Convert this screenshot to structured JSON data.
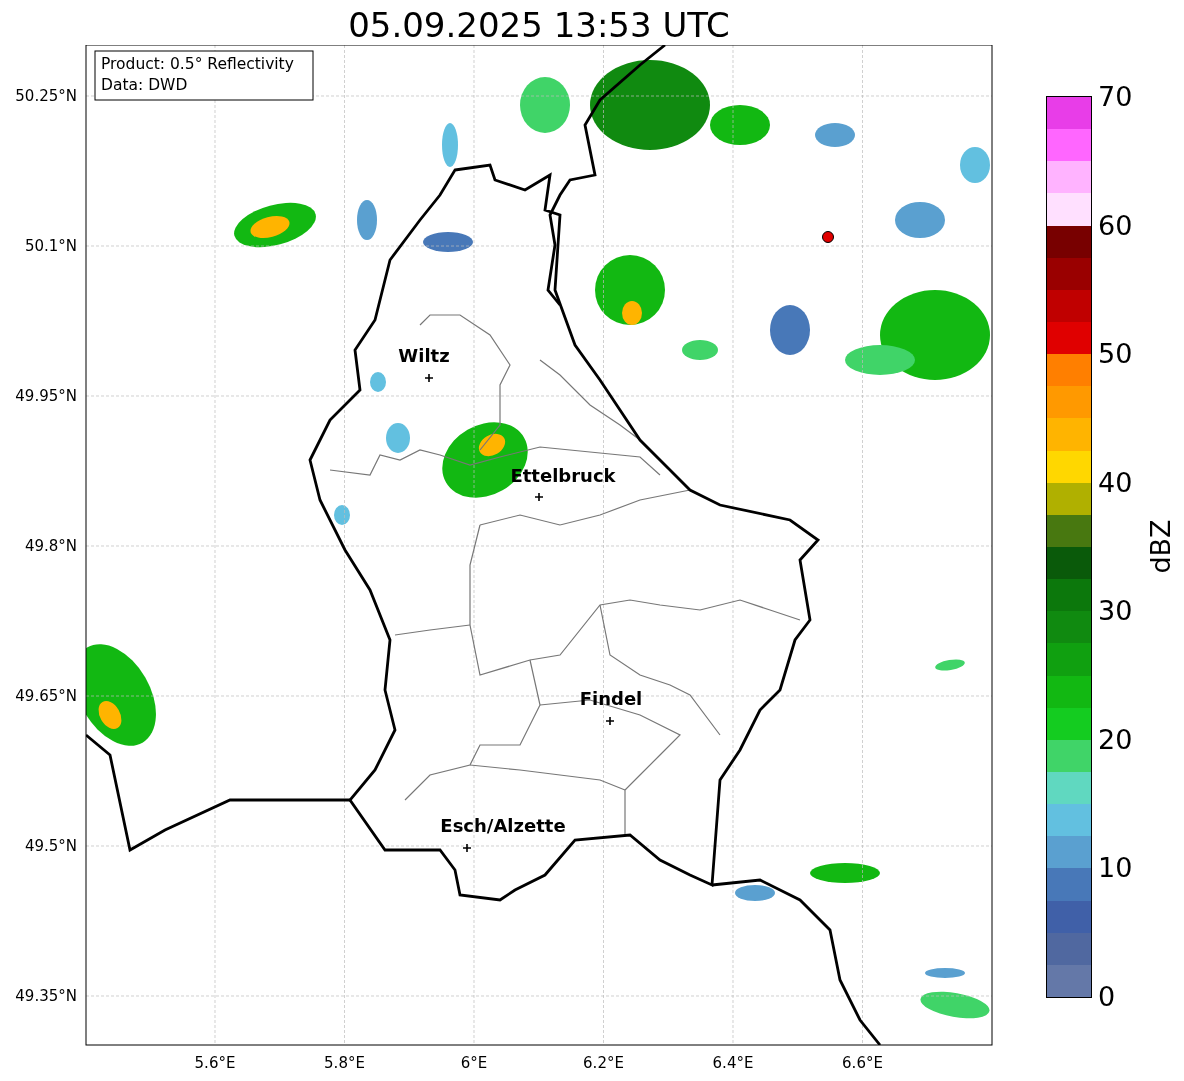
{
  "title": "05.09.2025 13:53 UTC",
  "info_box": {
    "lines": [
      "Product: 0.5° Reflectivity",
      "Data: DWD"
    ]
  },
  "map": {
    "lat_ticks": [
      "50.25°N",
      "50.1°N",
      "49.95°N",
      "49.8°N",
      "49.65°N",
      "49.5°N",
      "49.35°N"
    ],
    "lon_ticks": [
      "5.6°E",
      "5.8°E",
      "6°E",
      "6.2°E",
      "6.4°E",
      "6.6°E"
    ],
    "cities": [
      {
        "name": "Wiltz"
      },
      {
        "name": "Ettelbruck"
      },
      {
        "name": "Findel"
      },
      {
        "name": "Esch/Alzette"
      }
    ]
  },
  "colorbar": {
    "label": "dBZ",
    "ticks": [
      "70",
      "60",
      "50",
      "40",
      "30",
      "20",
      "10",
      "0"
    ],
    "bins": [
      {
        "color": "#e83de8"
      },
      {
        "color": "#ff66ff"
      },
      {
        "color": "#ffb3ff"
      },
      {
        "color": "#ffe0ff"
      },
      {
        "color": "#780000"
      },
      {
        "color": "#9a0000"
      },
      {
        "color": "#c00000"
      },
      {
        "color": "#e00000"
      },
      {
        "color": "#ff7f00"
      },
      {
        "color": "#ff9900"
      },
      {
        "color": "#ffb400"
      },
      {
        "color": "#ffd700"
      },
      {
        "color": "#b0b000"
      },
      {
        "color": "#487810"
      },
      {
        "color": "#0a5a0a"
      },
      {
        "color": "#0c780c"
      },
      {
        "color": "#108a10"
      },
      {
        "color": "#10a010"
      },
      {
        "color": "#12b812"
      },
      {
        "color": "#14cc20"
      },
      {
        "color": "#40d468"
      },
      {
        "color": "#60d8c0"
      },
      {
        "color": "#62c0e0"
      },
      {
        "color": "#5aa0d0"
      },
      {
        "color": "#4878b8"
      },
      {
        "color": "#4060a8"
      },
      {
        "color": "#5068a0"
      },
      {
        "color": "#6478a8"
      }
    ]
  }
}
